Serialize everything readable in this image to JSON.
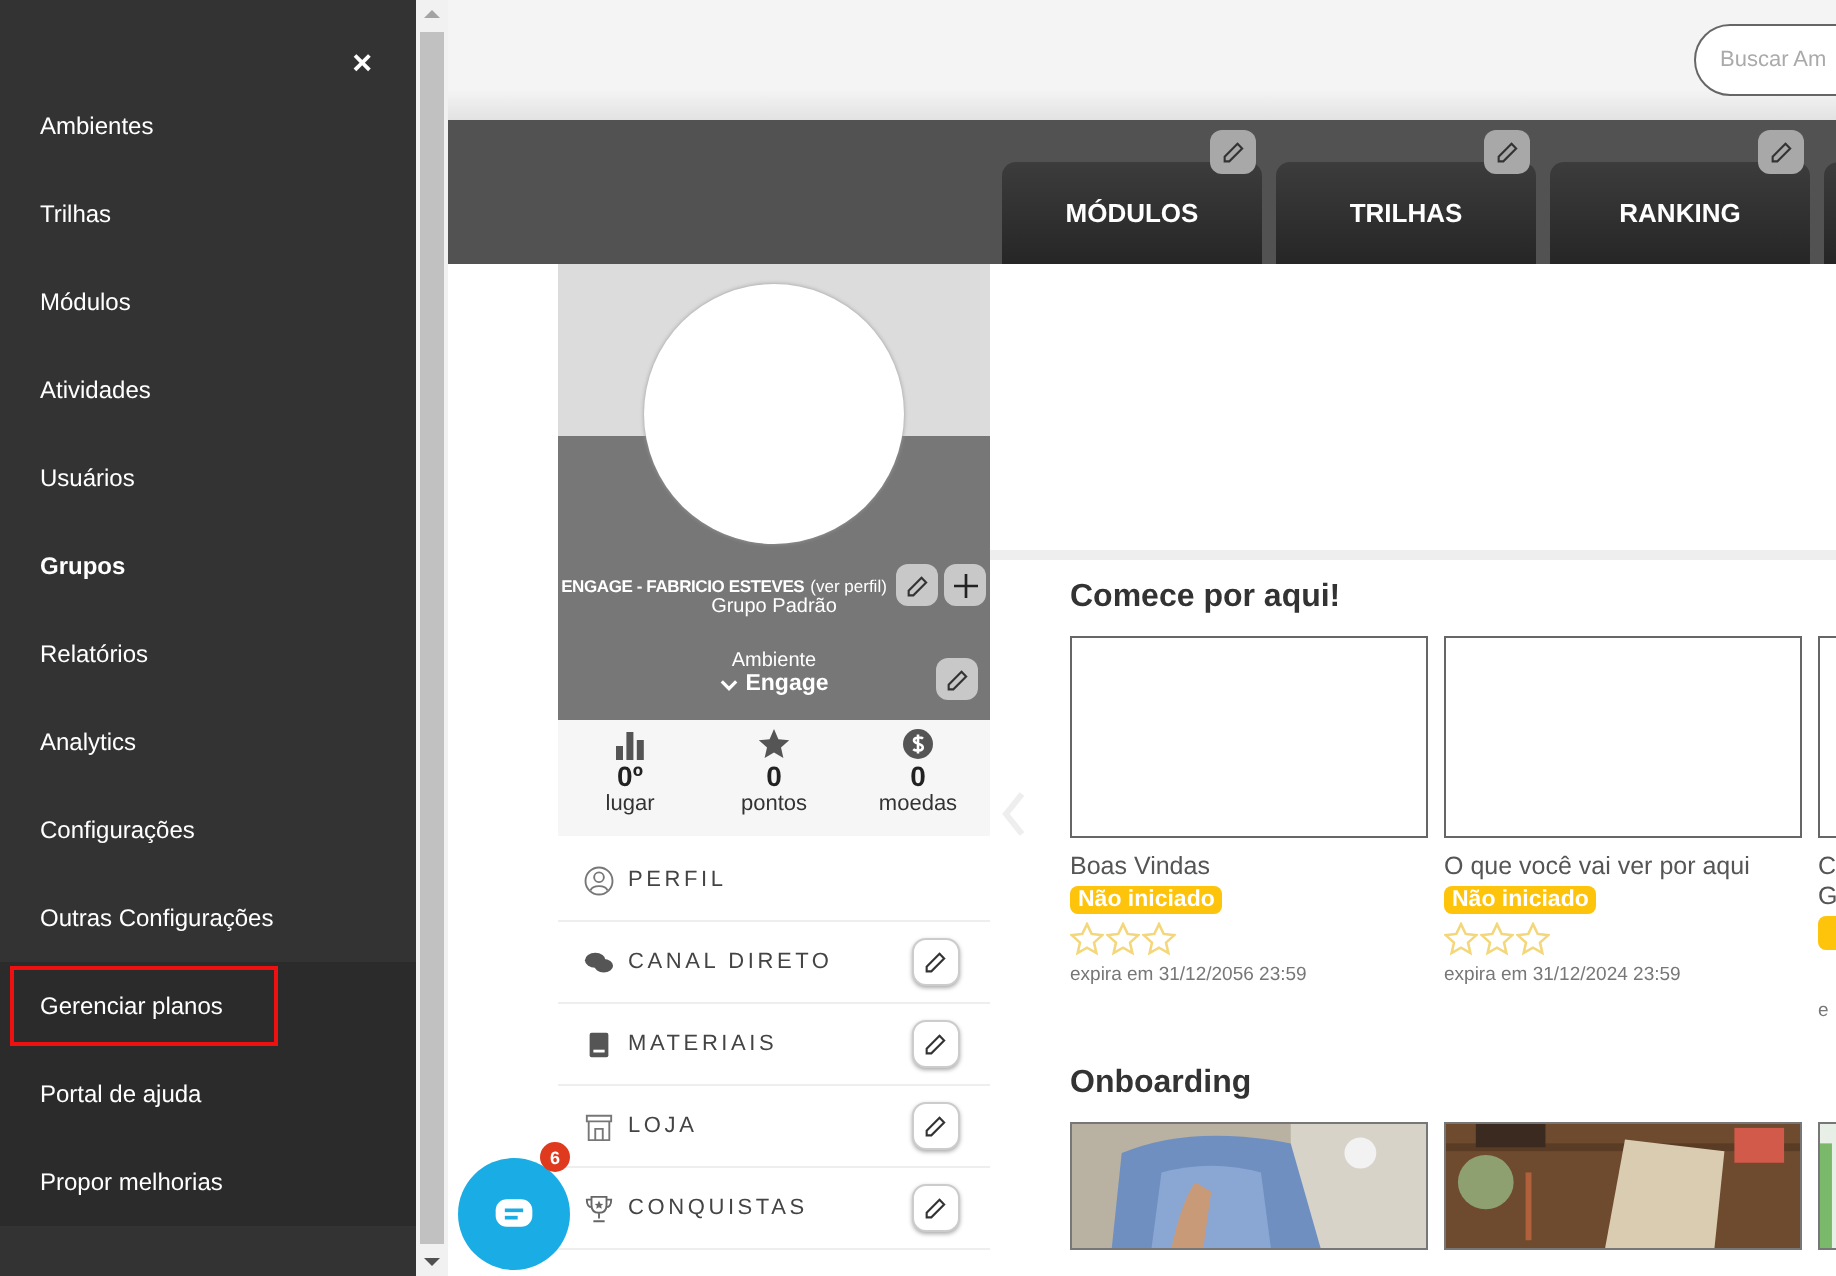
{
  "sidebar": {
    "close_label": "×",
    "items": [
      {
        "label": "Ambientes",
        "bold": false,
        "outlined": false
      },
      {
        "label": "Trilhas",
        "bold": false,
        "outlined": false
      },
      {
        "label": "Módulos",
        "bold": false,
        "outlined": false
      },
      {
        "label": "Atividades",
        "bold": false,
        "outlined": false
      },
      {
        "label": "Usuários",
        "bold": false,
        "outlined": false
      },
      {
        "label": "Grupos",
        "bold": true,
        "outlined": false
      },
      {
        "label": "Relatórios",
        "bold": false,
        "outlined": false
      },
      {
        "label": "Analytics",
        "bold": false,
        "outlined": false
      },
      {
        "label": "Configurações",
        "bold": false,
        "outlined": false
      },
      {
        "label": "Outras Configurações",
        "bold": false,
        "outlined": false
      },
      {
        "label": "Gerenciar planos",
        "bold": false,
        "outlined": true
      },
      {
        "label": "Portal de ajuda",
        "bold": false,
        "outlined": false
      },
      {
        "label": "Propor melhorias",
        "bold": false,
        "outlined": false
      }
    ]
  },
  "search": {
    "placeholder": "Buscar Am"
  },
  "tabs": [
    {
      "label": "MÓDULOS"
    },
    {
      "label": "TRILHAS"
    },
    {
      "label": "RANKING"
    }
  ],
  "profile": {
    "name": "ENGAGE - FABRICIO ESTEVES",
    "link": "(ver perfil)",
    "group": "Grupo Padrão",
    "environment_label": "Ambiente",
    "environment": "Engage",
    "stats": [
      {
        "kind": "place",
        "value": "0º",
        "label": "lugar"
      },
      {
        "kind": "points",
        "value": "0",
        "label": "pontos"
      },
      {
        "kind": "coins",
        "value": "0",
        "label": "moedas"
      }
    ],
    "menu": [
      {
        "kind": "profile",
        "label": "PERFIL",
        "editable": false
      },
      {
        "kind": "chat",
        "label": "CANAL DIRETO",
        "editable": true
      },
      {
        "kind": "book",
        "label": "MATERIAIS",
        "editable": true
      },
      {
        "kind": "store",
        "label": "LOJA",
        "editable": true
      },
      {
        "kind": "trophy",
        "label": "CONQUISTAS",
        "editable": true
      }
    ]
  },
  "sections": [
    {
      "title": "Comece por aqui!",
      "cards": [
        {
          "title": "Boas Vindas",
          "status": "Não iniciado",
          "stars": 0,
          "expiry": "expira em 31/12/2056 23:59"
        },
        {
          "title": "O que você vai ver por aqui",
          "status": "Não iniciado",
          "stars": 0,
          "expiry": "expira em 31/12/2024 23:59"
        },
        {
          "title": "C\nG",
          "expiry": "e"
        }
      ]
    },
    {
      "title": "Onboarding"
    }
  ],
  "chat": {
    "badge": "6"
  }
}
